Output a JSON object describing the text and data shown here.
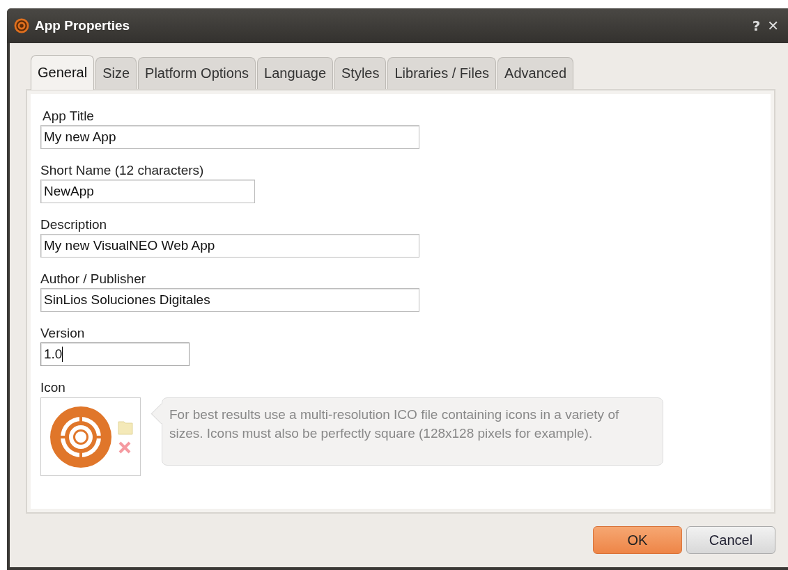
{
  "window": {
    "title": "App Properties",
    "help": "?",
    "close": "✕"
  },
  "tabs": [
    {
      "label": "General",
      "selected": true
    },
    {
      "label": "Size",
      "selected": false
    },
    {
      "label": "Platform Options",
      "selected": false
    },
    {
      "label": "Language",
      "selected": false
    },
    {
      "label": "Styles",
      "selected": false
    },
    {
      "label": "Libraries / Files",
      "selected": false
    },
    {
      "label": "Advanced",
      "selected": false
    }
  ],
  "fields": [
    {
      "label": "App Title",
      "value": "My new App",
      "focused": false
    },
    {
      "label": "Short Name (12 characters)",
      "value": "NewApp",
      "focused": false
    },
    {
      "label": "Description",
      "value": "My new VisualNEO Web App",
      "focused": false
    },
    {
      "label": "Author / Publisher",
      "value": "SinLios Soluciones Digitales",
      "focused": false
    },
    {
      "label": "Version",
      "value": "1.0",
      "focused": true
    }
  ],
  "icon": {
    "label": "Icon",
    "hint": "For best results use a multi-resolution ICO file containing icons in a variety of sizes. Icons must also be perfectly square (128x128 pixels for example)."
  },
  "buttons": [
    {
      "label": "OK",
      "kind": "primary"
    },
    {
      "label": "Cancel",
      "kind": "default"
    }
  ]
}
